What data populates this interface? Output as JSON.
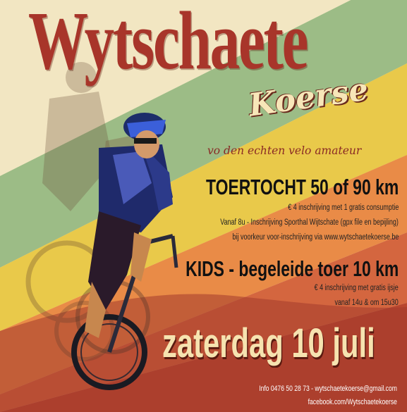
{
  "poster": {
    "title": "Wytschaete",
    "subtitle": "Koerse",
    "tagline": "vo den echten velo amateur",
    "events": [
      {
        "title": "TOERTOCHT 50 of 90 km",
        "lines": [
          "€ 4 inschrijving met 1 gratis consumptie",
          "Vanaf 8u - Inschrijving Sporthal Wijtschate (gpx file en bepijling)",
          "bij voorkeur voor-inschrijving via www.wytschaetekoerse.be"
        ]
      },
      {
        "title": "KIDS - begeleide toer 10 km",
        "lines": [
          "€ 4 inschrijving met gratis ijsje",
          "vanaf 14u & om 15u30"
        ]
      }
    ],
    "date": "zaterdag 10 juli",
    "contact": {
      "info": "Info 0476 50 28 73 - wytschaetekoerse@gmail.com",
      "facebook": "facebook.com/Wytschaetekoerse"
    }
  },
  "colors": {
    "title": "#a8352a",
    "band_cream": "#f2e6c2",
    "band_green": "#9cbc86",
    "band_yellow": "#e9c94a",
    "band_orange": "#e98b47",
    "band_red": "#c9533e",
    "band_dark": "#a33a2c"
  }
}
